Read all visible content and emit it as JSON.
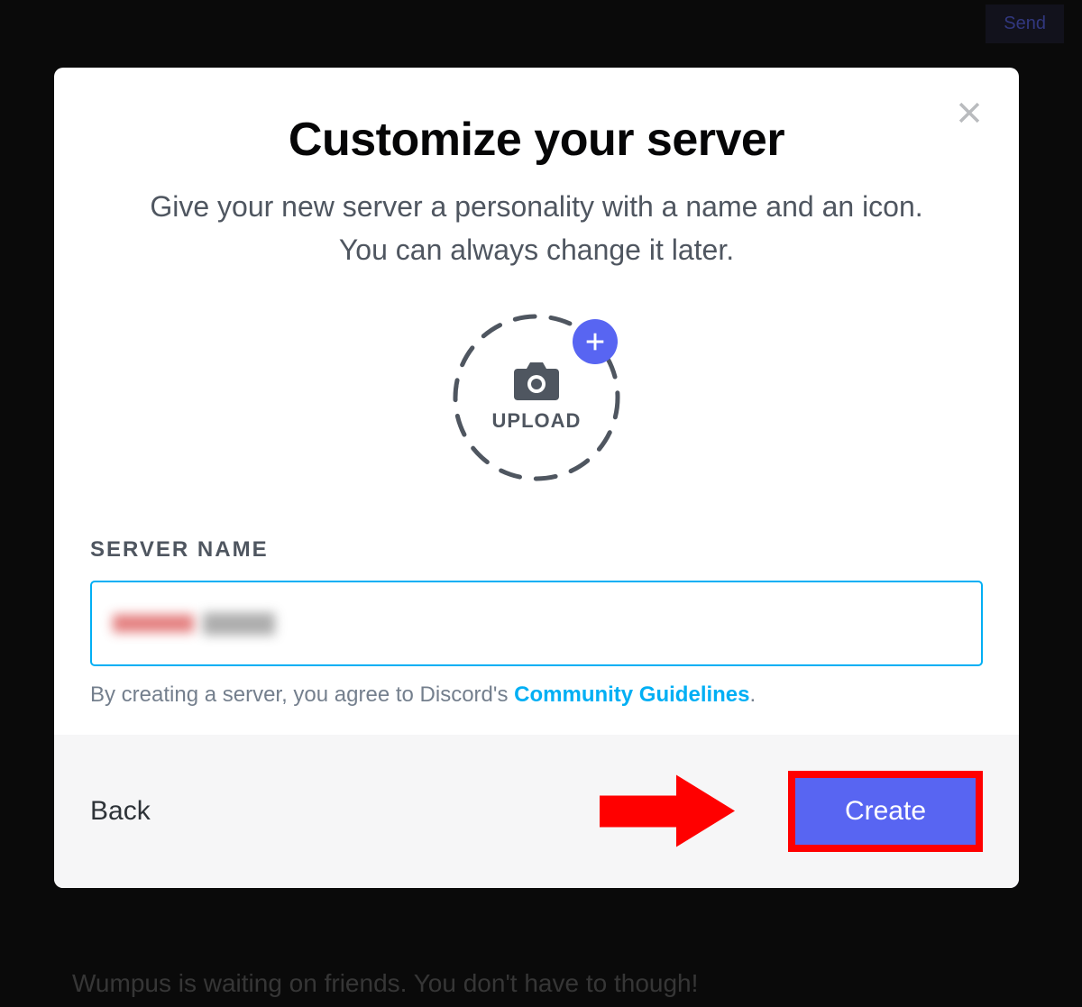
{
  "backdrop": {
    "send_label": "Send",
    "wumpus_text": "Wumpus is waiting on friends. You don't have to though!"
  },
  "modal": {
    "title": "Customize your server",
    "subtitle": "Give your new server a personality with a name and an icon. You can always change it later.",
    "upload_label": "UPLOAD",
    "field_label": "SERVER NAME",
    "server_name_value": "",
    "tos_prefix": "By creating a server, you agree to Discord's ",
    "tos_link_label": "Community Guidelines",
    "tos_suffix": "."
  },
  "footer": {
    "back_label": "Back",
    "create_label": "Create"
  },
  "colors": {
    "accent": "#5865f2",
    "link": "#00aff4",
    "annotation": "#ff0000"
  }
}
